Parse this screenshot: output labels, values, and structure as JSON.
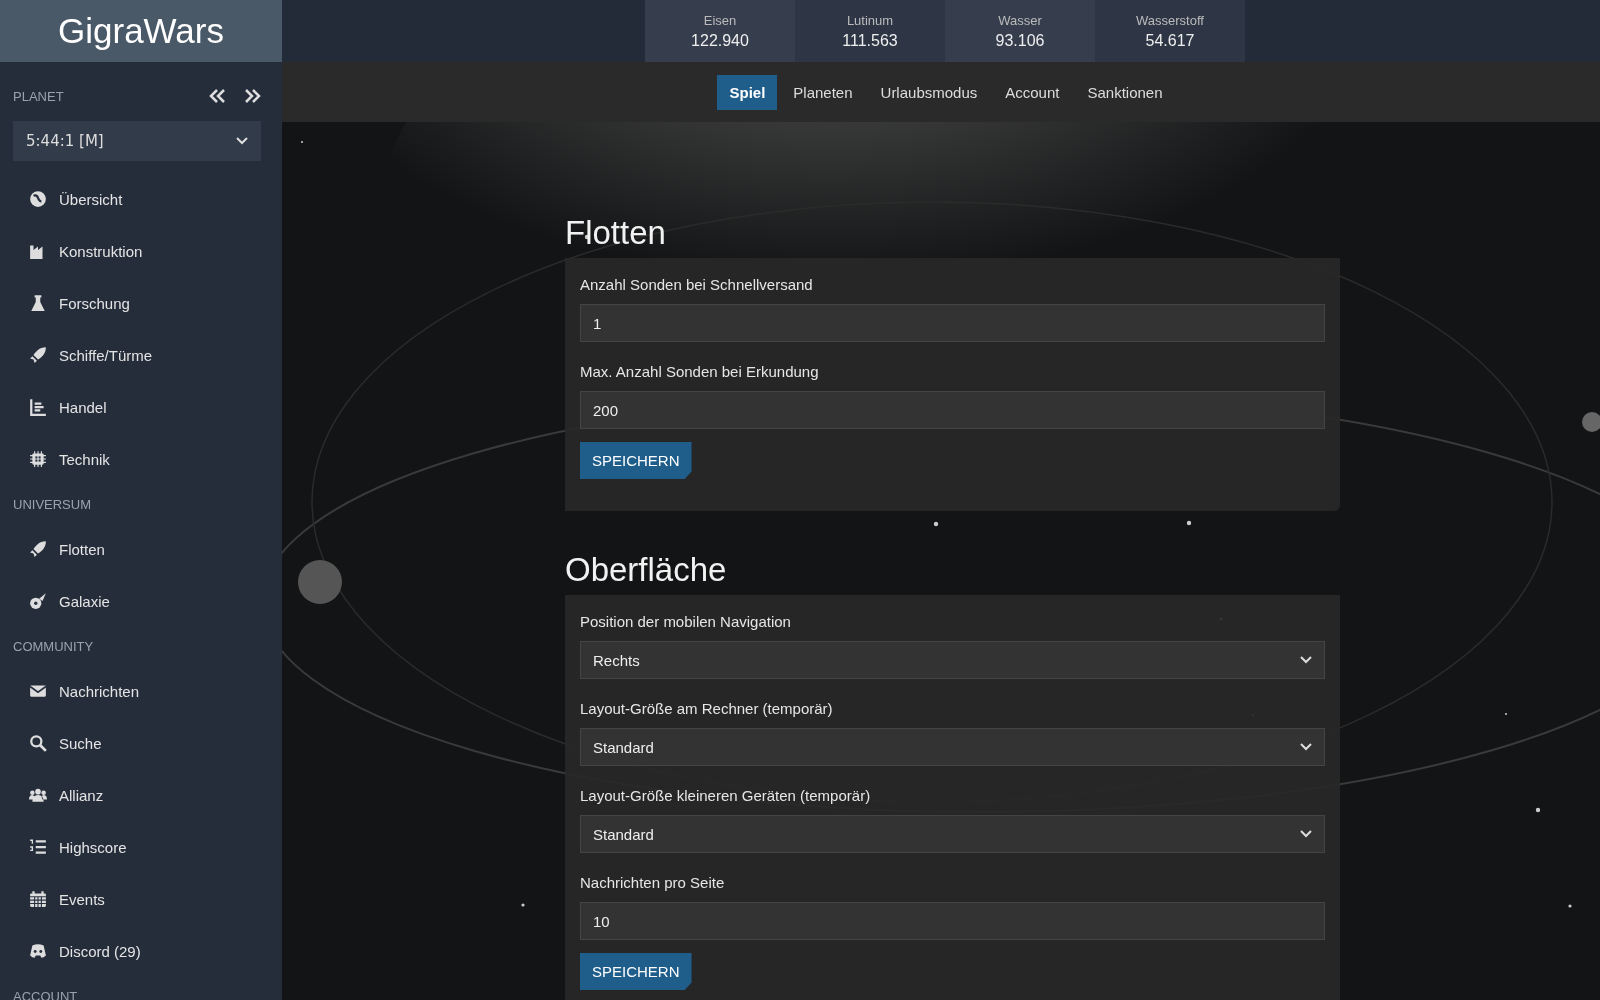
{
  "logo": "GigraWars",
  "resources": [
    {
      "label": "Eisen",
      "value": "122.940"
    },
    {
      "label": "Lutinum",
      "value": "111.563"
    },
    {
      "label": "Wasser",
      "value": "93.106"
    },
    {
      "label": "Wasserstoff",
      "value": "54.617"
    }
  ],
  "tabs": [
    {
      "label": "Spiel",
      "selected": true
    },
    {
      "label": "Planeten",
      "selected": false
    },
    {
      "label": "Urlaubsmodus",
      "selected": false
    },
    {
      "label": "Account",
      "selected": false
    },
    {
      "label": "Sanktionen",
      "selected": false
    }
  ],
  "sidebar": {
    "planet_label": "PLANET",
    "planet": "5:44:1 [M]",
    "sections": [
      {
        "items": [
          "Übersicht",
          "Konstruktion",
          "Forschung",
          "Schiffe/Türme",
          "Handel",
          "Technik"
        ]
      },
      {
        "title": "UNIVERSUM",
        "items": [
          "Flotten",
          "Galaxie"
        ]
      },
      {
        "title": "COMMUNITY",
        "items": [
          "Nachrichten",
          "Suche",
          "Allianz",
          "Highscore",
          "Events",
          "Discord (29)"
        ]
      },
      {
        "title": "ACCOUNT"
      }
    ]
  },
  "panels": [
    {
      "title": "Flotten",
      "fields": [
        {
          "kind": "input",
          "label": "Anzahl Sonden bei Schnellversand",
          "value": "1"
        },
        {
          "kind": "input",
          "label": "Max. Anzahl Sonden bei Erkundung",
          "value": "200"
        }
      ],
      "button": "SPEICHERN"
    },
    {
      "title": "Oberfläche",
      "fields": [
        {
          "kind": "select",
          "label": "Position der mobilen Navigation",
          "value": "Rechts"
        },
        {
          "kind": "select",
          "label": "Layout-Größe am Rechner (temporär)",
          "value": "Standard"
        },
        {
          "kind": "select",
          "label": "Layout-Größe kleineren Geräten (temporär)",
          "value": "Standard"
        },
        {
          "kind": "input",
          "label": "Nachrichten pro Seite",
          "value": "10"
        }
      ],
      "button": "SPEICHERN"
    }
  ]
}
